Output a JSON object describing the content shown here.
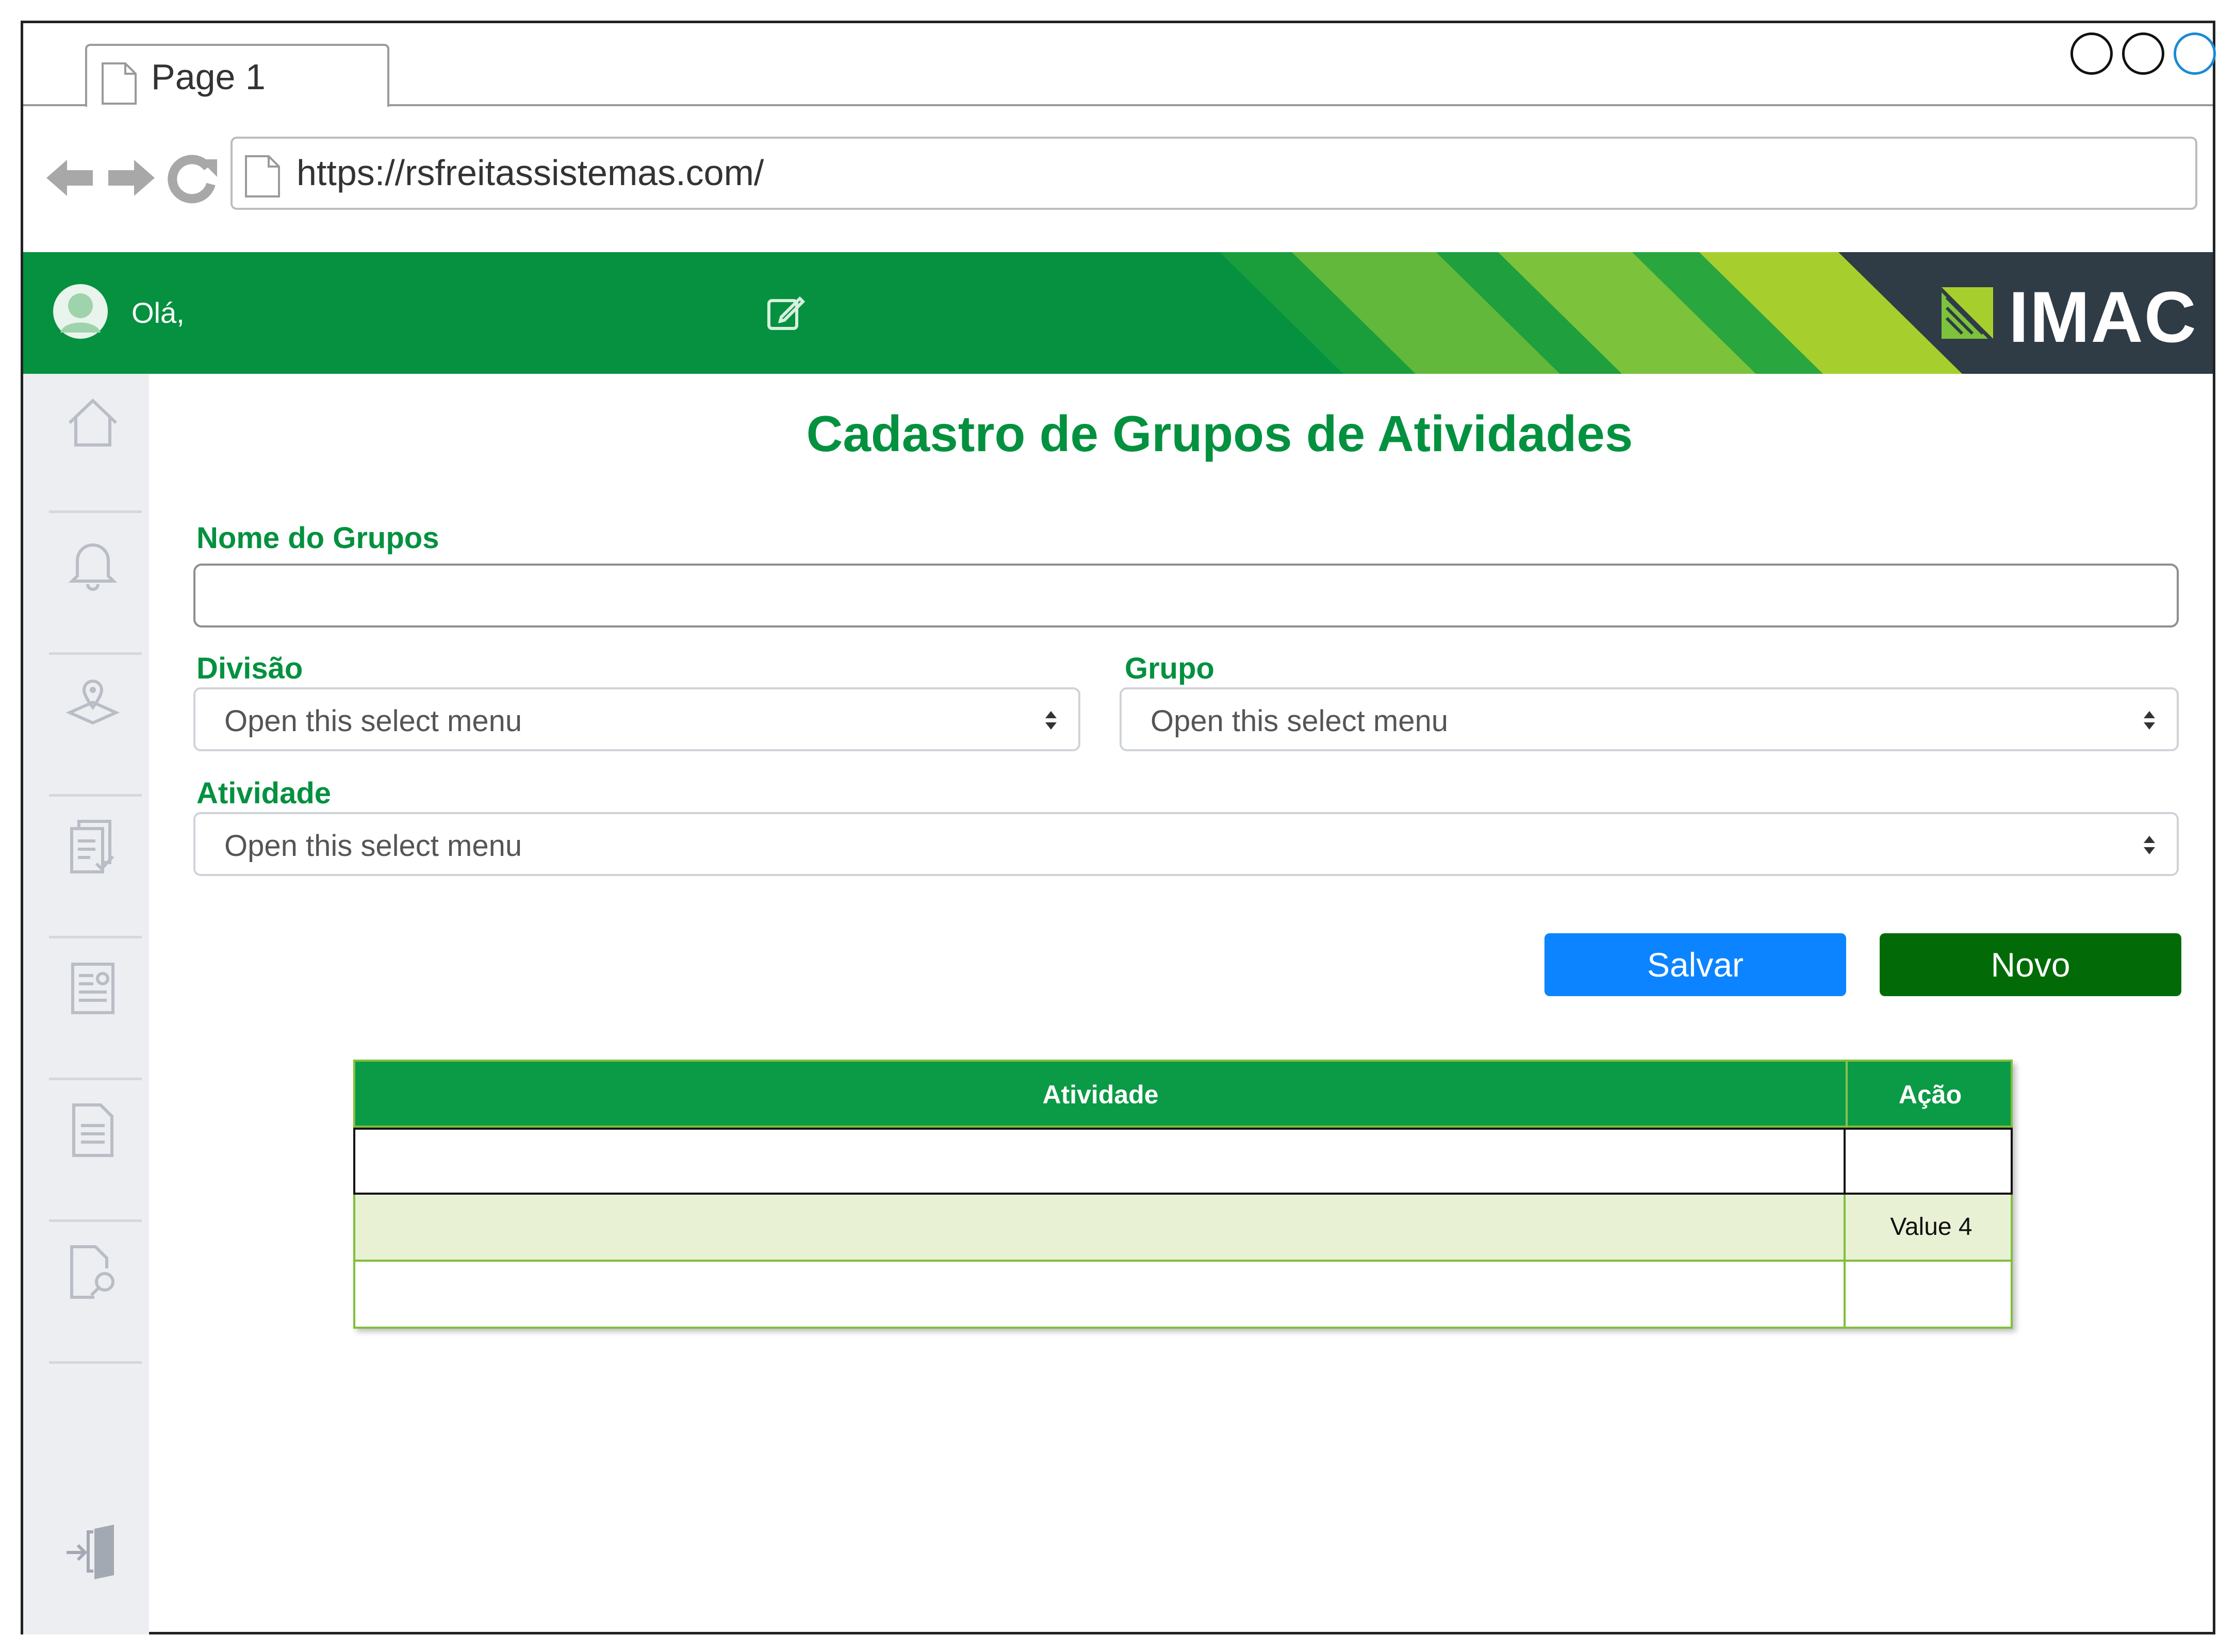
{
  "browser": {
    "tab_title": "Page 1",
    "url": "https://rsfreitassistemas.com/"
  },
  "header": {
    "greeting": "Olá,",
    "logo_text": "IMAC",
    "brand_green": "#059140",
    "logo_dark": "#2f3b45"
  },
  "sidebar": {
    "items": [
      {
        "name": "home-icon"
      },
      {
        "name": "bell-icon"
      },
      {
        "name": "map-pin-icon"
      },
      {
        "name": "documents-check-icon"
      },
      {
        "name": "certificate-icon"
      },
      {
        "name": "document-icon"
      },
      {
        "name": "document-search-icon"
      },
      {
        "name": "logout-icon"
      }
    ]
  },
  "form": {
    "title": "Cadastro de Grupos de Atividades",
    "nome_label": "Nome do Grupos",
    "nome_value": "",
    "divisao_label": "Divisão",
    "divisao_placeholder": "Open this select menu",
    "grupo_label": "Grupo",
    "grupo_placeholder": "Open this select menu",
    "atividade_label": "Atividade",
    "atividade_placeholder": "Open this select menu",
    "save_label": "Salvar",
    "new_label": "Novo"
  },
  "table": {
    "columns": [
      "Atividade",
      "Ação"
    ],
    "rows": [
      [
        "",
        ""
      ],
      [
        "",
        "Value 4"
      ],
      [
        "",
        ""
      ]
    ]
  },
  "colors": {
    "primary_green": "#03913f",
    "save_blue": "#0d84ff",
    "new_green": "#026b07",
    "row_highlight": "#e9f1d5"
  }
}
